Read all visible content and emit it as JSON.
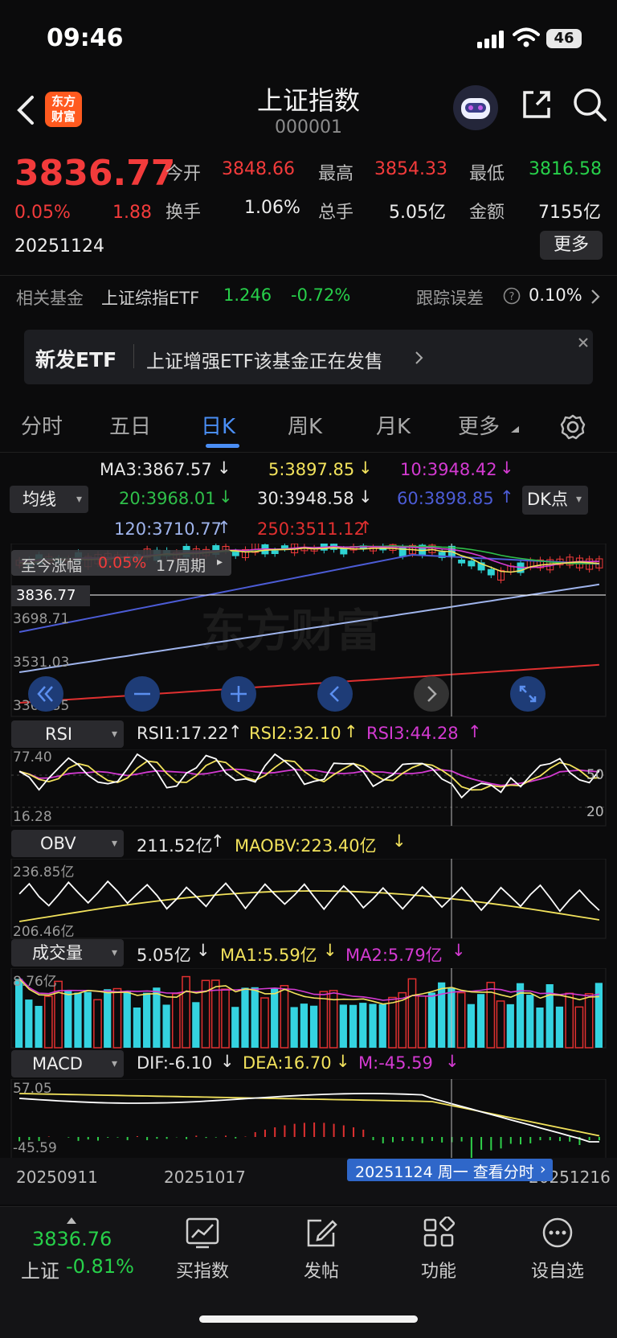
{
  "status": {
    "time": "09:46",
    "battery": "46"
  },
  "header": {
    "title": "上证指数",
    "code": "000001",
    "logo_line1": "东方",
    "logo_line2": "财富"
  },
  "quote": {
    "price": "3836.77",
    "change_pct": "0.05%",
    "change": "1.88",
    "date": "20251124",
    "open_label": "今开",
    "open": "3848.66",
    "high_label": "最高",
    "high": "3854.33",
    "low_label": "最低",
    "low": "3816.58",
    "turnover_label": "换手",
    "turnover": "1.06%",
    "volume_label": "总手",
    "volume": "5.05亿",
    "amount_label": "金额",
    "amount": "7155亿",
    "more": "更多"
  },
  "fund": {
    "label": "相关基金",
    "name": "上证综指ETF",
    "price": "1.246",
    "pct": "-0.72%",
    "err_label": "跟踪误差",
    "err": "0.10%"
  },
  "banner": {
    "tag": "新发ETF",
    "text": "上证增强ETF该基金正在发售"
  },
  "tabs": [
    "分时",
    "五日",
    "日K",
    "周K",
    "月K",
    "更多"
  ],
  "ma": {
    "selector": "均线",
    "ma3": "MA3:3867.57",
    "ma5": "5:3897.85",
    "ma10": "10:3948.42",
    "ma20": "20:3968.01",
    "ma30": "30:3948.58",
    "ma60": "60:3898.85",
    "ma120": "120:3710.77",
    "ma250": "250:3511.12",
    "dk": "DK点",
    "colors": {
      "ma3": "#e6e6e6",
      "ma5": "#f2e25c",
      "ma10": "#d33ad1",
      "ma20": "#2fbf4a",
      "ma30": "#e6e6e6",
      "ma60": "#4c5cd6",
      "ma120": "#9fb4ec",
      "ma250": "#e03030"
    }
  },
  "kline": {
    "range_label": "至今涨幅",
    "range_pct": "0.05%",
    "range_period": "17周期",
    "price_tag": "3836.77",
    "axis": [
      "3698.71",
      "3531.03",
      "3363.35"
    ],
    "watermark": "东方财富"
  },
  "rsi": {
    "selector": "RSI",
    "rsi1": "RSI1:17.22",
    "rsi2": "RSI2:32.10",
    "rsi3": "RSI3:44.28",
    "ymax": "77.40",
    "ymin": "16.28",
    "r50": "50",
    "r20": "20"
  },
  "obv": {
    "selector": "OBV",
    "obv": "211.52亿",
    "maobv": "MAOBV:223.40亿",
    "ymax": "236.85亿",
    "ymin": "206.46亿"
  },
  "vol": {
    "selector": "成交量",
    "vol": "5.05亿",
    "ma1": "MA1:5.59亿",
    "ma2": "MA2:5.79亿",
    "ymax": "8.76亿"
  },
  "macd": {
    "selector": "MACD",
    "dif": "DIF:-6.10",
    "dea": "DEA:16.70",
    "m": "M:-45.59",
    "ymax": "57.05",
    "ymin": "-45.59"
  },
  "dates": {
    "d1": "20250911",
    "d2": "20251017",
    "d3": "20251216",
    "cursor": "20251124 周一  查看分时"
  },
  "bottom": {
    "index_price": "3836.76",
    "index_name": "上证",
    "index_pct": "-0.81%",
    "items": [
      "买指数",
      "发帖",
      "功能",
      "设自选"
    ]
  }
}
